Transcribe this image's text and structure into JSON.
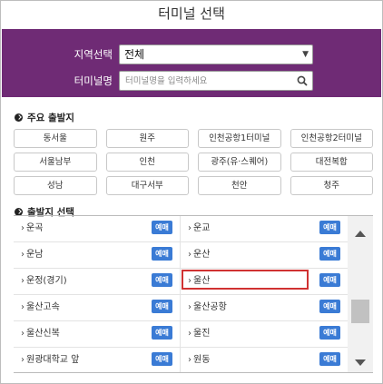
{
  "header": {
    "title": "터미널 선택"
  },
  "filter": {
    "region_label": "지역선택",
    "region_value": "전체",
    "terminal_label": "터미널명",
    "terminal_placeholder": "터미널명을 입력하세요"
  },
  "major": {
    "title": "주요 출발지",
    "items": [
      "동서울",
      "원주",
      "인천공항1터미널",
      "인천공항2터미널",
      "서울남부",
      "인천",
      "광주(유·스퀘어)",
      "대전복합",
      "성남",
      "대구서부",
      "천안",
      "청주"
    ]
  },
  "departure": {
    "title": "출발지 선택",
    "reserve_label": "예매",
    "items": [
      "운곡",
      "운교",
      "운남",
      "운산",
      "운정(경기)",
      "울산",
      "울산고속",
      "울산공항",
      "울산신복",
      "울진",
      "원광대학교 앞",
      "원동"
    ],
    "selected": "울산"
  },
  "colors": {
    "filter_bg": "#6f2b75",
    "reserve_btn": "#3a7bd5",
    "highlight": "#d03232"
  },
  "icons": [
    "search-icon",
    "chevron-down-icon",
    "check-circle-icon",
    "chevron-right-icon",
    "scroll-up-icon",
    "scroll-down-icon"
  ]
}
